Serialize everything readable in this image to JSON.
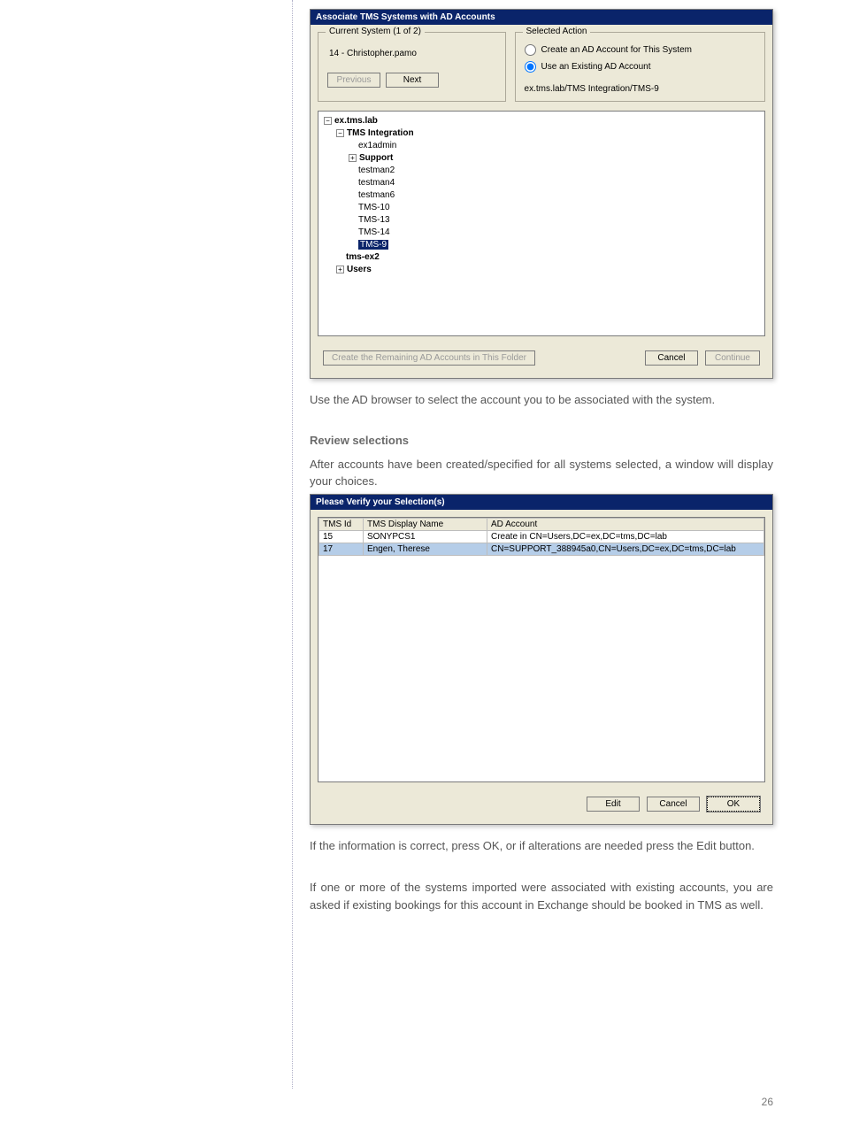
{
  "dialog1": {
    "title": "Associate TMS Systems with AD Accounts",
    "current_group": "Current System (1 of 2)",
    "system_name": "14 - Christopher.pamo",
    "btn_prev": "Previous",
    "btn_next": "Next",
    "action_group": "Selected Action",
    "radio_create": "Create an AD Account for This System",
    "radio_existing": "Use an Existing AD Account",
    "path": "ex.tms.lab/TMS Integration/TMS-9",
    "tree": {
      "root": "ex.tms.lab",
      "child1": "TMS Integration",
      "items": [
        "ex1admin",
        "Support",
        "testman2",
        "testman4",
        "testman6",
        "TMS-10",
        "TMS-13",
        "TMS-14",
        "TMS-9"
      ],
      "child2": "tms-ex2",
      "child3": "Users"
    },
    "btn_create_remaining": "Create the Remaining AD Accounts in This Folder",
    "btn_cancel": "Cancel",
    "btn_continue": "Continue"
  },
  "para1": "Use the AD browser to select the account you to be associated with the system.",
  "subhead": "Review selections",
  "para2": "After accounts have been created/specified for all systems selected, a window will display your choices.",
  "dialog2": {
    "title": "Please Verify your Selection(s)",
    "cols": [
      "TMS Id",
      "TMS Display Name",
      "AD Account"
    ],
    "rows": [
      {
        "id": "15",
        "name": "SONYPCS1",
        "acct": "Create in CN=Users,DC=ex,DC=tms,DC=lab"
      },
      {
        "id": "17",
        "name": "Engen, Therese",
        "acct": "CN=SUPPORT_388945a0,CN=Users,DC=ex,DC=tms,DC=lab"
      }
    ],
    "btn_edit": "Edit",
    "btn_cancel": "Cancel",
    "btn_ok": "OK"
  },
  "para3": "If the information is correct, press OK, or if alterations are needed press the Edit button.",
  "para4": "If one or more of the systems imported were associated with existing accounts, you are asked if existing bookings for this account in Exchange should be booked in TMS as well.",
  "page_number": "26"
}
